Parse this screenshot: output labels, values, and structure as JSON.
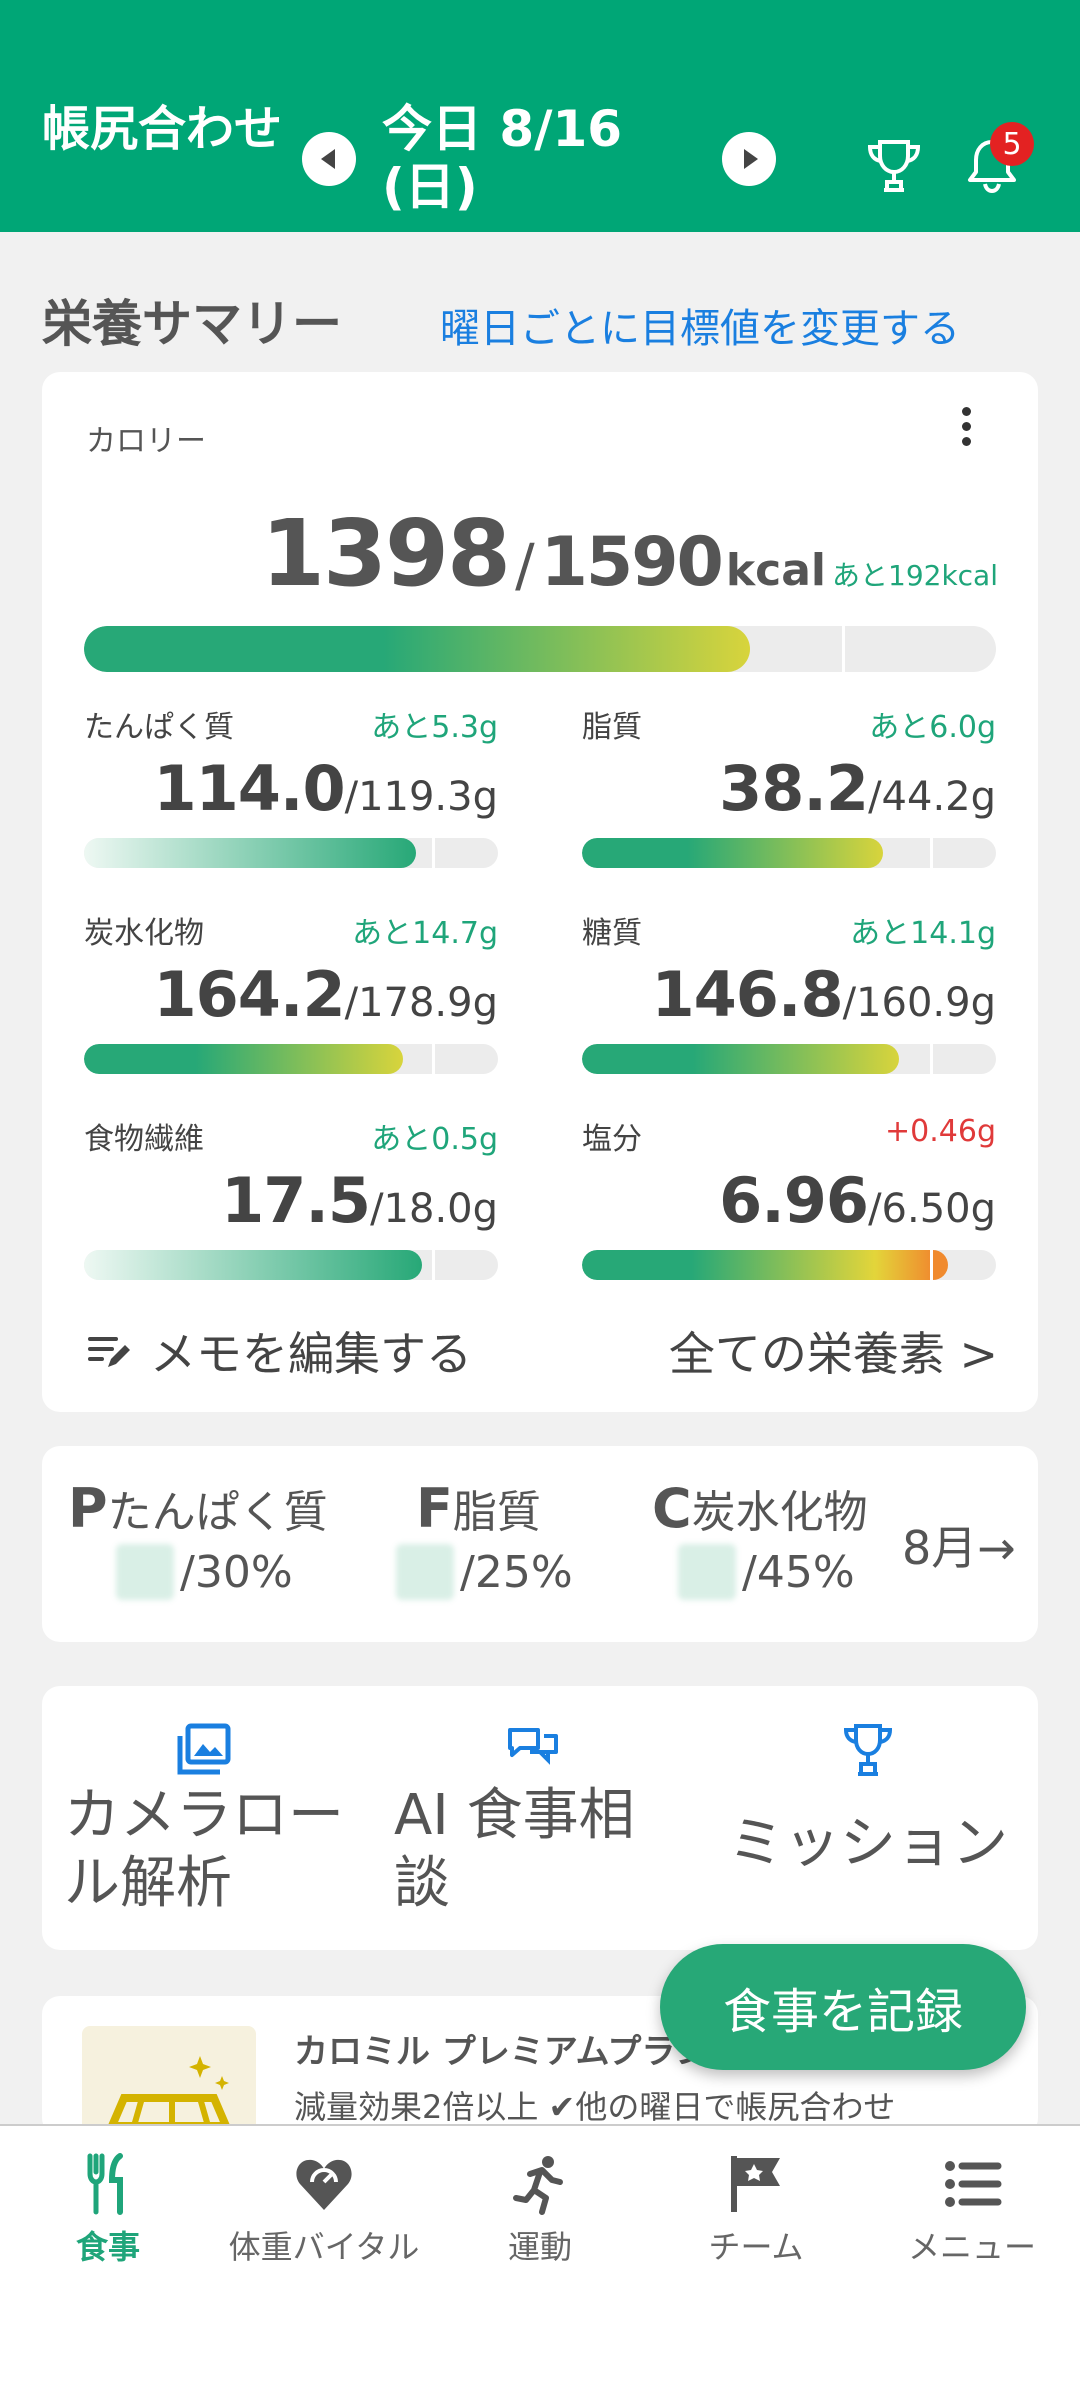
{
  "header": {
    "title": "帳尻合わせ",
    "date": "今日 8/16 (日)",
    "notification_count": "5"
  },
  "summary": {
    "title": "栄養サマリー",
    "link": "曜日ごとに目標値を変更する"
  },
  "calorie": {
    "label": "カロリー",
    "value": "1398",
    "slash": "/",
    "goal": "1590",
    "unit": "kcal",
    "remaining": "あと192kcal",
    "progress": 0.879
  },
  "nutrients": [
    {
      "name": "たんぱく質",
      "remaining": "あと5.3g",
      "value": "114.0",
      "goal": "/119.3g",
      "progress": 0.955,
      "style": "light"
    },
    {
      "name": "脂質",
      "remaining": "あと6.0g",
      "value": "38.2",
      "goal": "/44.2g",
      "progress": 0.864,
      "style": "warm"
    },
    {
      "name": "炭水化物",
      "remaining": "あと14.7g",
      "value": "164.2",
      "goal": "/178.9g",
      "progress": 0.918,
      "style": "warm"
    },
    {
      "name": "糖質",
      "remaining": "あと14.1g",
      "value": "146.8",
      "goal": "/160.9g",
      "progress": 0.912,
      "style": "warm"
    },
    {
      "name": "食物繊維",
      "remaining": "あと0.5g",
      "value": "17.5",
      "goal": "/18.0g",
      "progress": 0.972,
      "style": "light"
    },
    {
      "name": "塩分",
      "remaining": "+0.46g",
      "value": "6.96",
      "goal": "/6.50g",
      "progress": 1.0,
      "style": "over"
    }
  ],
  "memo_label": "メモを編集する",
  "all_nutrients_label": "全ての栄養素 >",
  "pfc": {
    "p_letter": "P",
    "p_name": "たんぱく質",
    "p_pct": "/30%",
    "f_letter": "F",
    "f_name": "脂質",
    "f_pct": "/25%",
    "c_letter": "C",
    "c_name": "炭水化物",
    "c_pct": "/45%",
    "month": "8月→"
  },
  "actions": {
    "camera": "カメラロール解析",
    "ai": "AI 食事相談",
    "mission": "ミッション"
  },
  "promo": {
    "title": "カロミル プレミアムプラン",
    "subtitle": "減量効果2倍以上 ✔他の曜日で帳尻合わせ"
  },
  "fab_label": "食事を記録",
  "nav": {
    "meal": "食事",
    "weight": "体重バイタル",
    "exercise": "運動",
    "team": "チーム",
    "menu": "メニュー"
  },
  "colors": {
    "brand": "#00a676",
    "link": "#1a7fe0",
    "accent_green": "#1fa57a",
    "over": "#e03a3a"
  }
}
